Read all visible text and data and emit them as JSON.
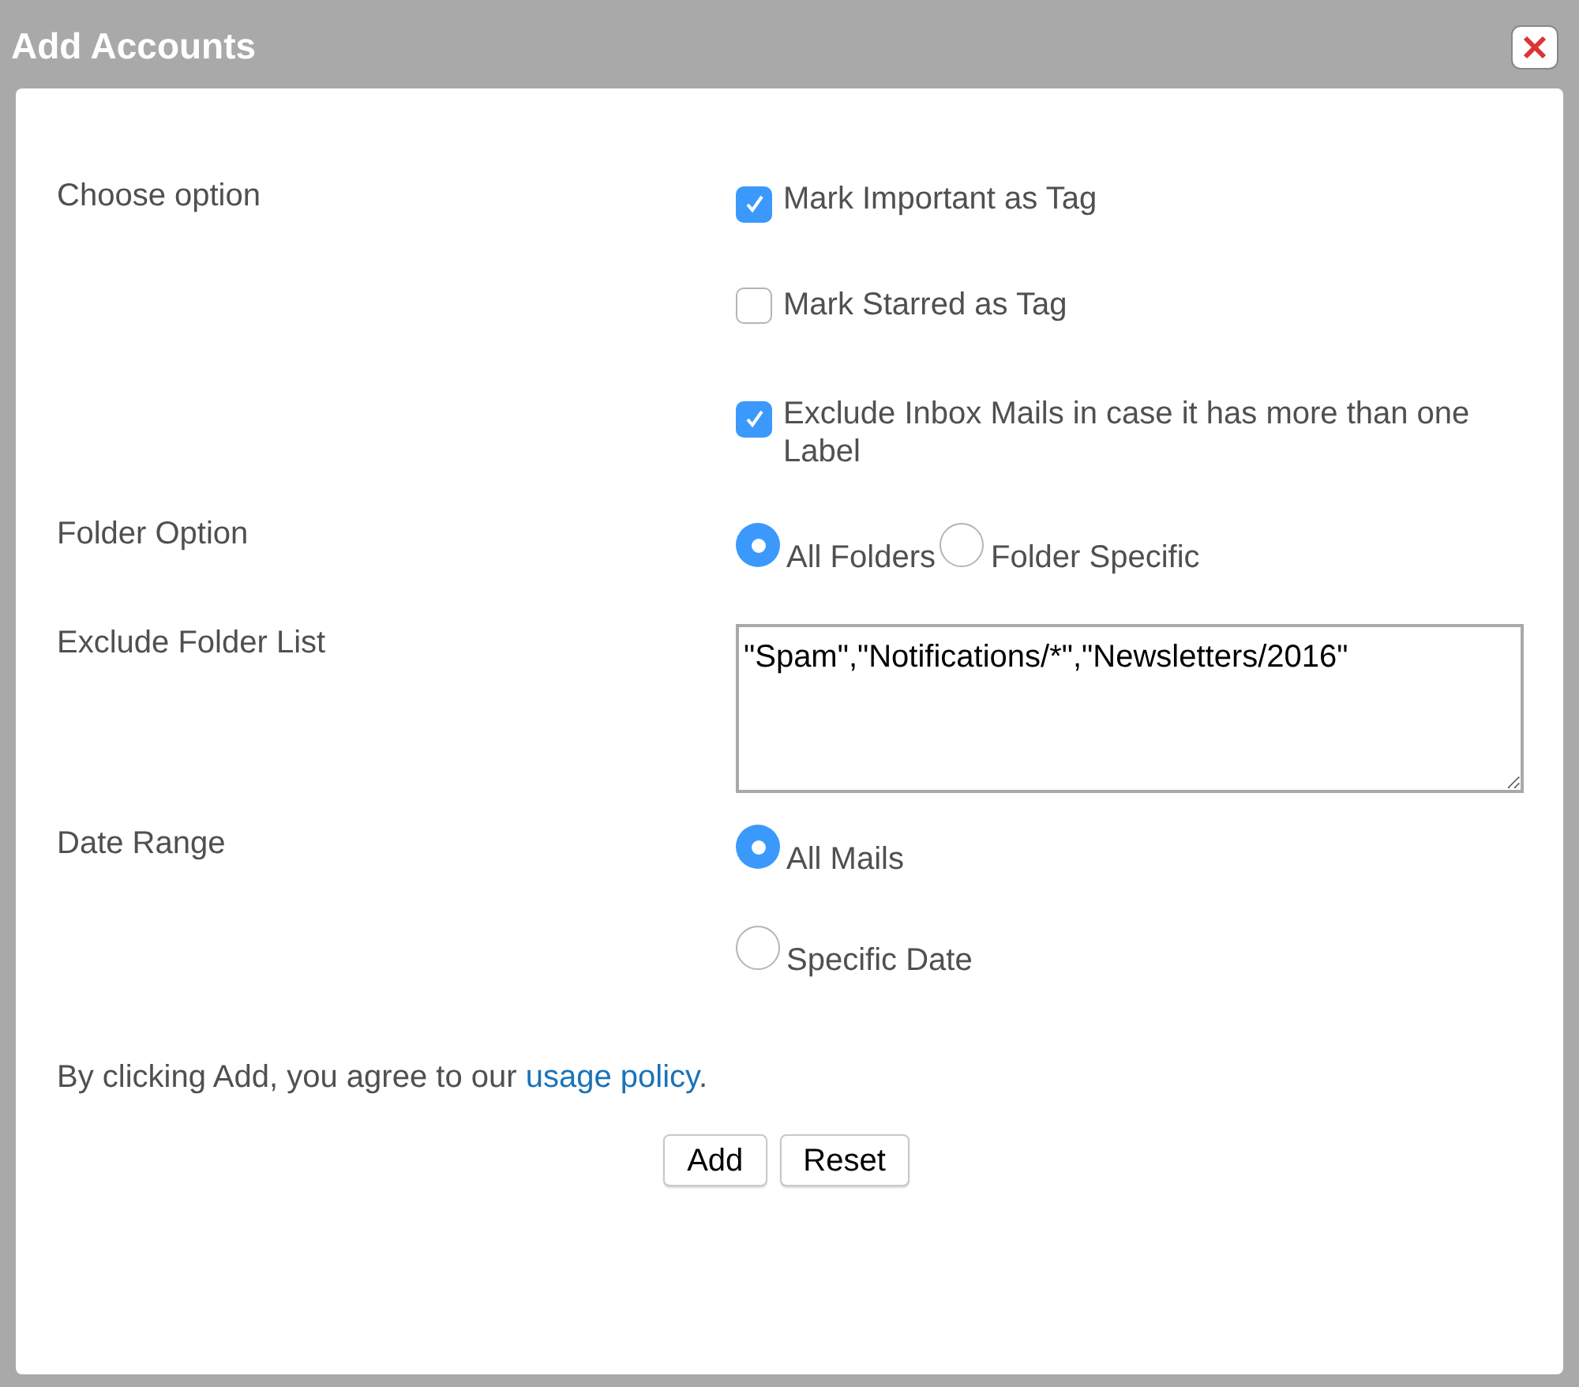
{
  "window": {
    "title": "Add Accounts"
  },
  "fields": [
    {
      "label": "Choose option",
      "kind": "checkboxes",
      "options": [
        {
          "label": "Mark Important as Tag",
          "checked": true
        },
        {
          "label": "Mark Starred as Tag",
          "checked": false
        },
        {
          "label": "Exclude Inbox Mails in case it has more than one Label",
          "checked": true
        }
      ]
    },
    {
      "label": "Folder Option",
      "kind": "radios_inline",
      "options": [
        {
          "label": "All Folders",
          "selected": true
        },
        {
          "label": "Folder Specific",
          "selected": false
        }
      ]
    },
    {
      "label": "Exclude Folder List",
      "kind": "textarea",
      "value": "\"Spam\",\"Notifications/*\",\"Newsletters/2016\""
    },
    {
      "label": "Date Range",
      "kind": "radios_stacked",
      "options": [
        {
          "label": "All Mails",
          "selected": true
        },
        {
          "label": "Specific Date",
          "selected": false
        }
      ]
    }
  ],
  "agreement": {
    "before": "By clicking Add, you agree to our ",
    "link": "usage policy",
    "after": "."
  },
  "buttons": [
    "Add",
    "Reset"
  ]
}
